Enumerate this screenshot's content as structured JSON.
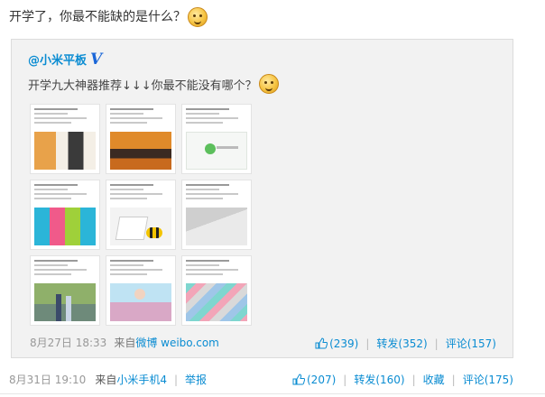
{
  "post": {
    "text": "开学了，你最不能缺的是什么？"
  },
  "repost": {
    "author": "@小米平板",
    "verified_mark": "V",
    "text": "开学九大神器推荐↓↓↓你最不能没有哪个？",
    "date": "8月27日 18:33",
    "via": "来自",
    "source": "微博 weibo.com",
    "likes": "(239)",
    "forward": "转发(352)",
    "comment": "评论(157)"
  },
  "footer": {
    "date": "8月31日 19:10",
    "via": "来自",
    "source": "小米手机4",
    "report": "举报",
    "likes": "(207)",
    "forward": "转发(160)",
    "favorite": "收藏",
    "comment": "评论(175)"
  },
  "separators": {
    "pipe": "|"
  }
}
